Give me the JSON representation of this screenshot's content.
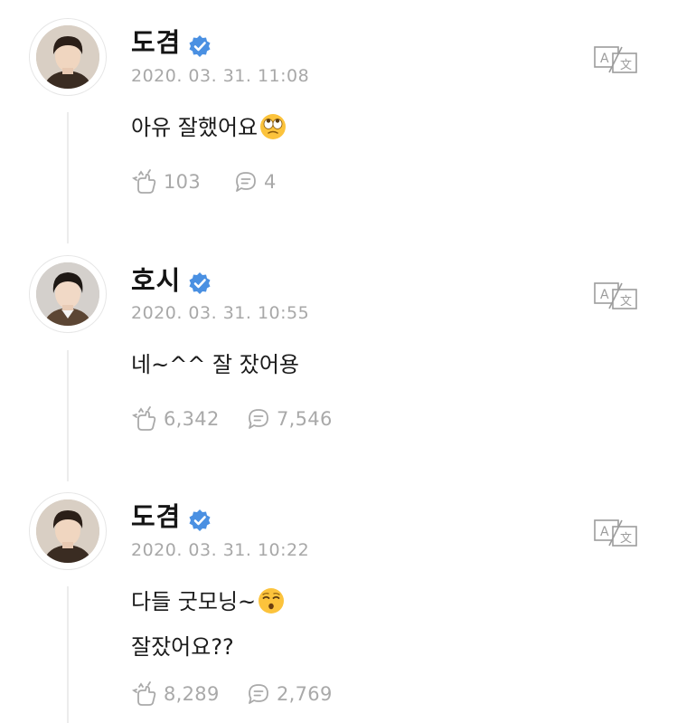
{
  "posts": [
    {
      "author": "도겸",
      "timestamp": "2020. 03. 31. 11:08",
      "lines": [
        "아유 잘했어요"
      ],
      "emoji": "eye-roll-emoji",
      "likes": "103",
      "comments": "4"
    },
    {
      "author": "호시",
      "timestamp": "2020. 03. 31. 10:55",
      "lines": [
        "네~^^ 잘 잤어용"
      ],
      "likes": "6,342",
      "comments": "7,546"
    },
    {
      "author": "도겸",
      "timestamp": "2020. 03. 31. 10:22",
      "lines": [
        "다들 굿모닝~",
        "잘잤어요??"
      ],
      "emoji": "kissing-emoji",
      "likes": "8,289",
      "comments": "2,769"
    }
  ],
  "colors": {
    "verified": "#4a90e2",
    "muted": "#a8a8a8",
    "thread": "#ececec"
  }
}
